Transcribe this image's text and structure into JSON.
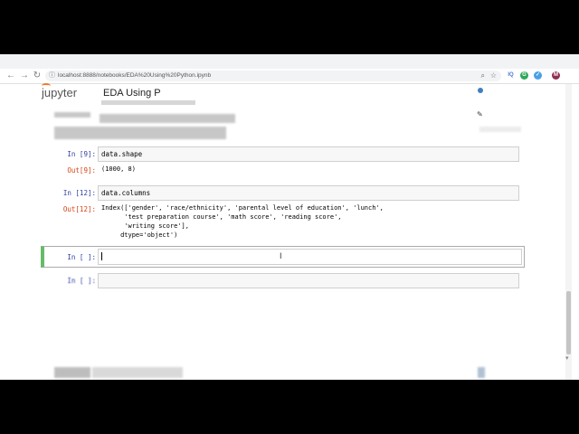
{
  "browser": {
    "url": "localhost:8888/notebooks/EDA%20Using%20Python.ipynb",
    "back_icon": "back-arrow-icon",
    "forward_icon": "forward-arrow-icon",
    "reload_icon": "reload-icon",
    "extensions": [
      {
        "label": "IQ",
        "color": "#4a7ad6"
      },
      {
        "label": "G",
        "color": "#2fa85a"
      },
      {
        "label": "✓",
        "color": "#49a0e6"
      },
      {
        "label": "M",
        "color": "#8f2f4f"
      }
    ]
  },
  "jupyter": {
    "logo_text": "jupyter",
    "notebook_title": "EDA Using P"
  },
  "cells": [
    {
      "in_prompt": "In [9]:",
      "code": "data.shape",
      "out_prompt": "Out[9]:",
      "output": "(1000, 8)"
    },
    {
      "in_prompt": "In [12]:",
      "code": "data.columns",
      "out_prompt": "Out[12]:",
      "output": "Index(['gender', 'race/ethnicity', 'parental level of education', 'lunch',\n      'test preparation course', 'math score', 'reading score',\n      'writing score'],\n     dtype='object')"
    },
    {
      "in_prompt": "In [ ]:",
      "code": ""
    },
    {
      "in_prompt": "In [ ]:",
      "code": ""
    }
  ]
}
